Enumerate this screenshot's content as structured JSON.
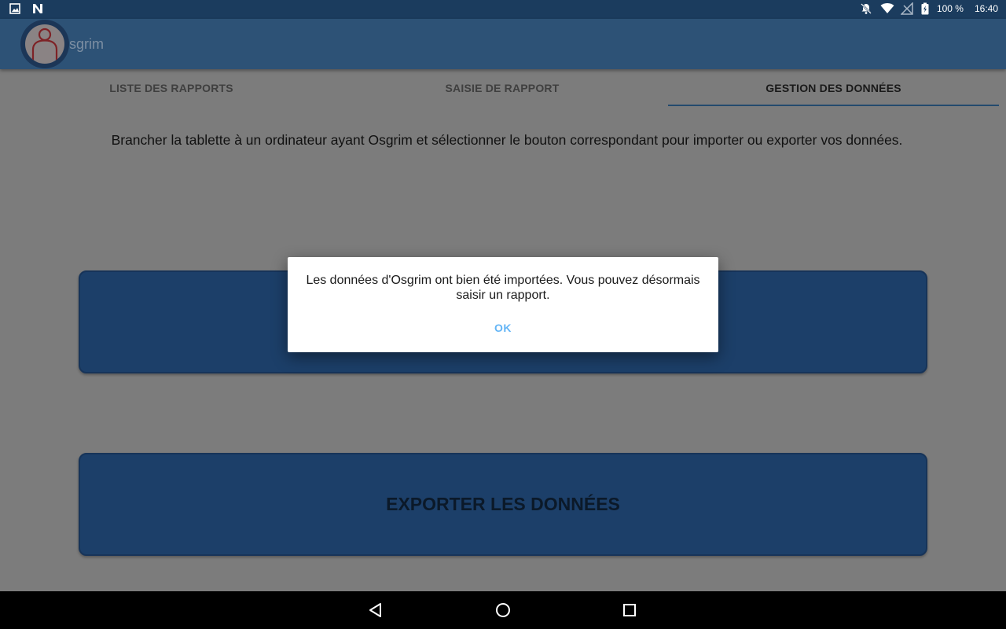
{
  "status_bar": {
    "left_icons": [
      "gallery-notification-icon",
      "n-notification-icon"
    ],
    "battery": "100 %",
    "time": "16:40",
    "right_icons": [
      "notifications-off-icon",
      "wifi-icon",
      "no-signal-icon",
      "battery-charging-icon"
    ]
  },
  "app_bar": {
    "title": "sgrim",
    "logo_icon": "person-logo-icon"
  },
  "tabs": [
    {
      "label": "LISTE DES RAPPORTS",
      "selected": false
    },
    {
      "label": "SAISIE DE RAPPORT",
      "selected": false
    },
    {
      "label": "GESTION DES DONNÉES",
      "selected": true
    }
  ],
  "main": {
    "instructions": "Brancher la tablette à un ordinateur ayant Osgrim et sélectionner le bouton correspondant pour importer ou exporter vos données.",
    "export_button": "EXPORTER LES DONNÉES"
  },
  "dialog": {
    "message": "Les données d'Osgrim ont bien été importées. Vous pouvez désormais saisir un rapport.",
    "ok_label": "OK"
  },
  "nav_bar": {
    "icons": [
      "back-icon",
      "home-icon",
      "recents-icon"
    ]
  },
  "colors": {
    "status_bar": "#1b3c5e",
    "app_bar": "#2d5276",
    "button_fill": "#1c3f69",
    "dialog_ok": "#64b5f6",
    "scrim_bg": "#7c7c7c"
  }
}
